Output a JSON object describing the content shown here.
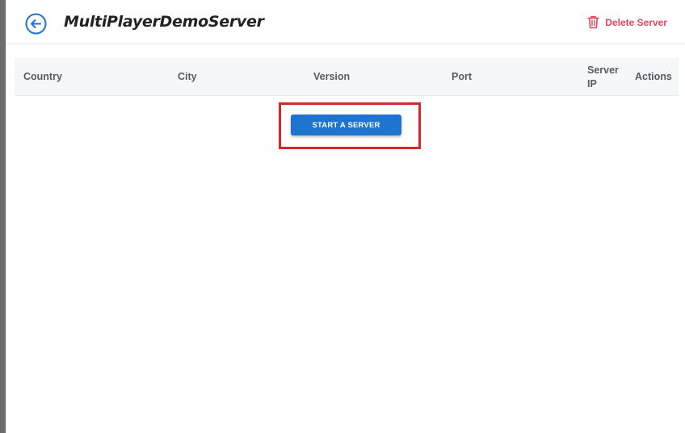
{
  "header": {
    "title": "MultiPlayerDemoServer",
    "back_icon": "arrow-left-circle-icon",
    "delete_label": "Delete Server",
    "delete_icon": "trash-icon",
    "accent_color": "#1f74d1",
    "danger_color": "#e0475c"
  },
  "table": {
    "columns": [
      "Country",
      "City",
      "Version",
      "Port",
      "Server IP",
      "Actions"
    ],
    "rows": []
  },
  "empty_state": {
    "start_button_label": "START A SERVER",
    "highlight_color": "#d62828"
  }
}
